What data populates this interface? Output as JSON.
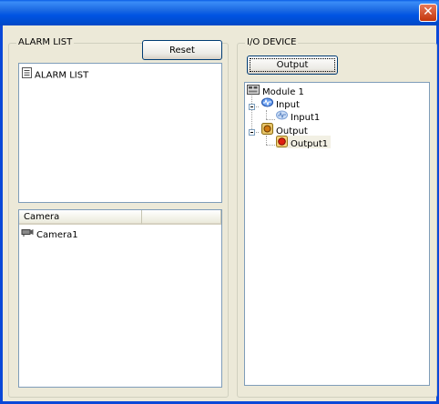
{
  "window": {
    "close_icon": "close-icon"
  },
  "alarm": {
    "group_label": "ALARM LIST",
    "reset_label": "Reset",
    "items": [
      {
        "label": "ALARM LIST",
        "icon": "document-list-icon"
      }
    ]
  },
  "camera": {
    "columns": [
      "Camera",
      ""
    ],
    "items": [
      {
        "label": "Camera1",
        "icon": "camera-icon"
      }
    ]
  },
  "io": {
    "group_label": "I/O DEVICE",
    "output_button": "Output",
    "tree": {
      "module": "Module 1",
      "input": "Input",
      "input1": "Input1",
      "output": "Output",
      "output1": "Output1"
    }
  }
}
